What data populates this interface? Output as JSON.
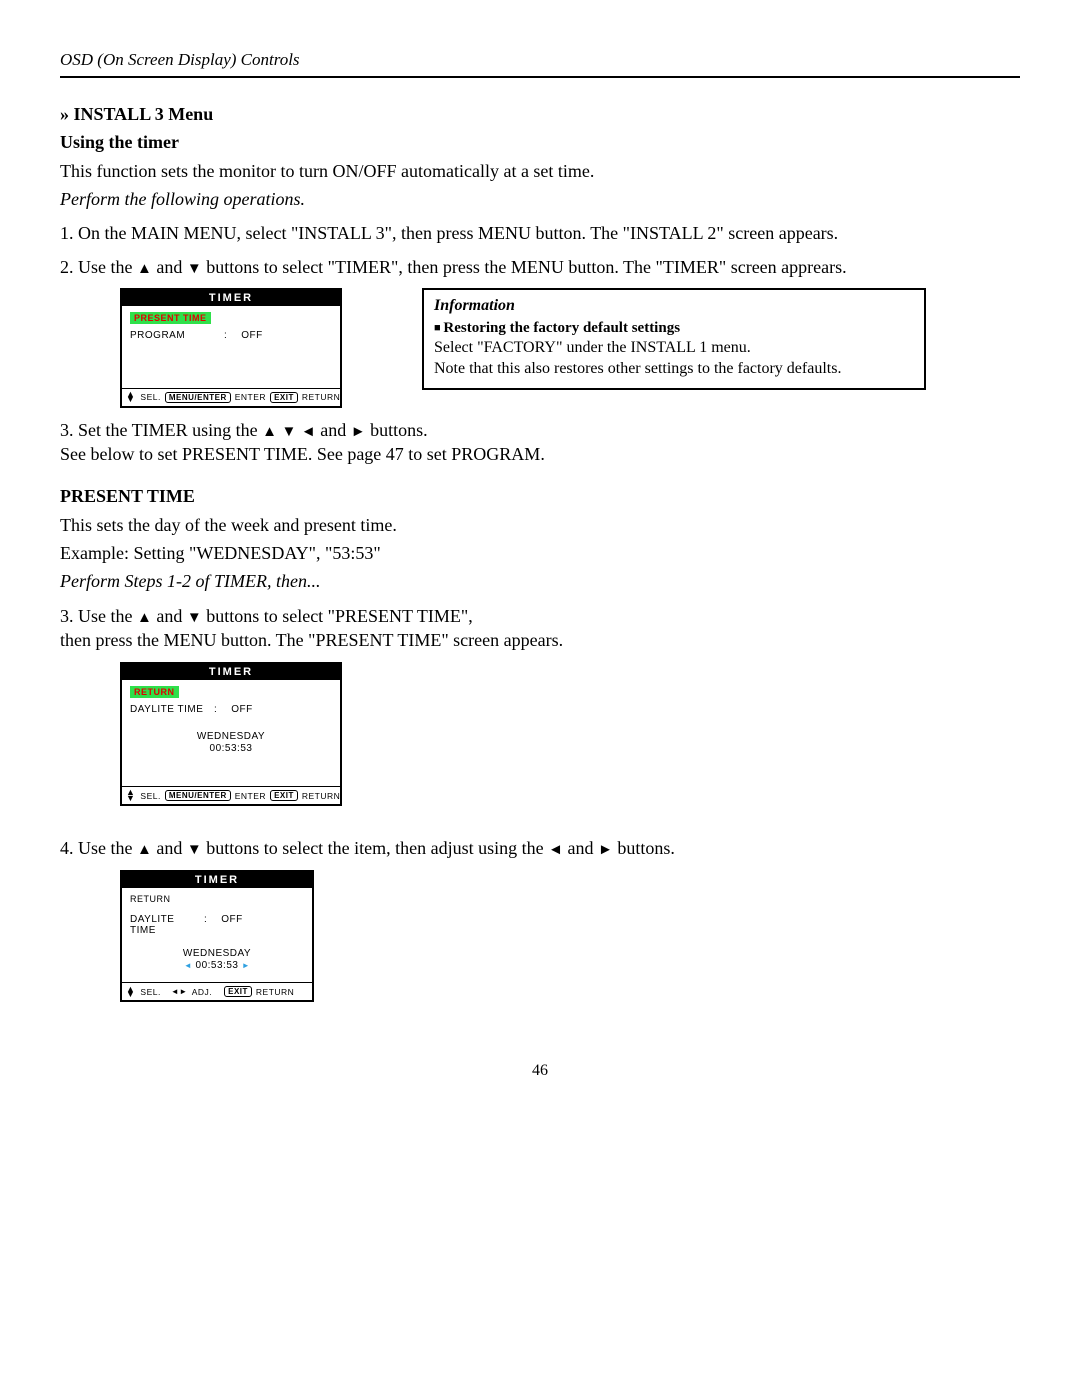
{
  "header": "OSD (On Screen Display) Controls",
  "h1": "» INSTALL 3 Menu",
  "subh1": "Using the timer",
  "intro": "This function sets the monitor to turn ON/OFF automatically at a set time.",
  "perform1": "Perform the following operations.",
  "step1": "1. On the MAIN MENU, select \"INSTALL 3\", then press MENU button.  The \"INSTALL 2\" screen appears.",
  "step2_a": "2. Use the ",
  "step2_b": " and ",
  "step2_c": " buttons to select \"TIMER\", then press the MENU button. The \"TIMER\" screen apprears.",
  "osd1": {
    "title": "TIMER",
    "hl": "PRESENT TIME",
    "program_label": "PROGRAM",
    "colon": ":",
    "program_val": "OFF",
    "sel": "SEL.",
    "menuenter": "MENU/ENTER",
    "enter": "ENTER",
    "exit": "EXIT",
    "return": "RETURN"
  },
  "info": {
    "title": "Information",
    "sub": "Restoring the factory default settings",
    "line1": "Select \"FACTORY\" under the INSTALL 1 menu.",
    "line2": "Note that this also restores other settings to the factory defaults."
  },
  "step3_a": "3. Set the TIMER using the ",
  "step3_b": " and ",
  "step3_c": " buttons.",
  "step3_d": "See below to set PRESENT TIME. See page 47 to set PROGRAM.",
  "present_h": "PRESENT TIME",
  "present_1": "This sets the day of the week and present time.",
  "present_2": "Example: Setting \"WEDNESDAY\", \"53:53\"",
  "perform2": "Perform Steps 1-2 of TIMER, then...",
  "pt_step3_a": "3. Use the ",
  "pt_step3_b": " and ",
  "pt_step3_c": " buttons to select \"PRESENT TIME\",",
  "pt_step3_d": "then press the MENU button. The \"PRESENT TIME\" screen appears.",
  "osd2": {
    "title": "TIMER",
    "hl": "RETURN",
    "daylite_label": "DAYLITE TIME",
    "colon": ":",
    "daylite_val": "OFF",
    "day": "WEDNESDAY",
    "time": "00:53:53",
    "sel": "SEL.",
    "menuenter": "MENU/ENTER",
    "enter": "ENTER",
    "exit": "EXIT",
    "return": "RETURN"
  },
  "step4_a": "4. Use the ",
  "step4_b": " and ",
  "step4_c": " buttons to select the item, then adjust using the ",
  "step4_d": " and ",
  "step4_e": " buttons.",
  "osd3": {
    "title": "TIMER",
    "return": "RETURN",
    "daylite_label": "DAYLITE TIME",
    "colon": ":",
    "daylite_val": "OFF",
    "day": "WEDNESDAY",
    "time": "00:53:53",
    "sel": "SEL.",
    "adj": "ADJ.",
    "exit": "EXIT",
    "return2": "RETURN"
  },
  "page_num": "46"
}
